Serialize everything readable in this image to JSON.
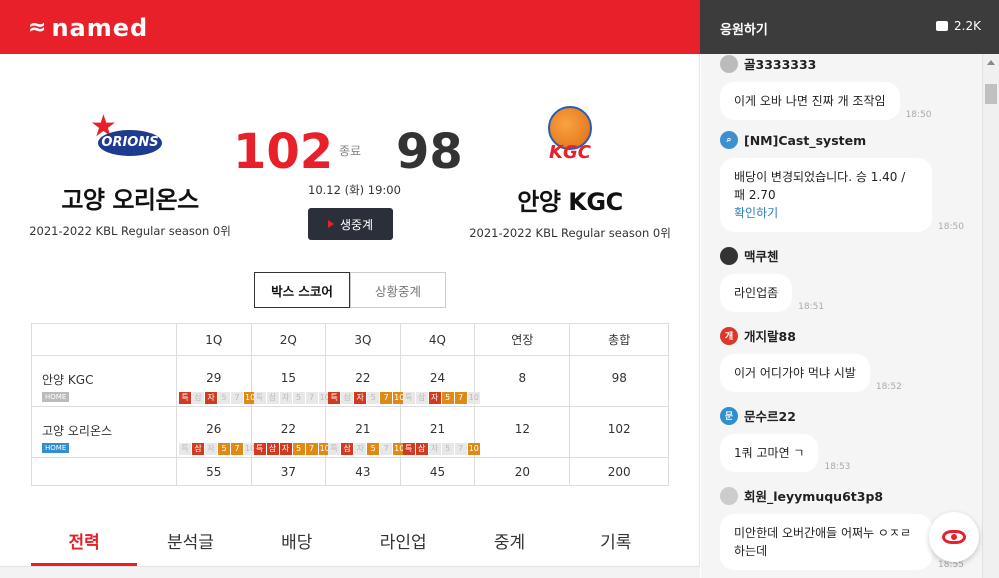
{
  "app": {
    "logo_text": "named",
    "logo_mark": "≈"
  },
  "chat_header": {
    "title": "응원하기",
    "count": "2.2K"
  },
  "game": {
    "away": {
      "name": "고양 오리온스",
      "season": "2021-2022 KBL Regular season 0위",
      "score": "102",
      "logo_text": "ORIONS"
    },
    "home": {
      "name": "안양 KGC",
      "season": "2021-2022 KBL Regular season 0위",
      "score": "98",
      "logo_text": "KGC"
    },
    "status": "종료",
    "datetime": "10.12 (화) 19:00",
    "live_button": "생중계"
  },
  "subtabs": [
    "박스 스코어",
    "상황중계"
  ],
  "boxscore": {
    "headers": [
      "",
      "1Q",
      "2Q",
      "3Q",
      "4Q",
      "연장",
      "총합"
    ],
    "rows": [
      {
        "team": "안양 KGC",
        "badge": "HOME",
        "scores": [
          "29",
          "15",
          "22",
          "24",
          "8",
          "98"
        ]
      },
      {
        "team": "고양 오리온스",
        "badge": "HOME",
        "scores": [
          "26",
          "22",
          "21",
          "21",
          "12",
          "102"
        ]
      }
    ],
    "totals": [
      "55",
      "37",
      "43",
      "45",
      "20",
      "200"
    ]
  },
  "tabs": [
    "전력",
    "분석글",
    "배당",
    "라인업",
    "중계",
    "기록"
  ],
  "chat": [
    {
      "user": "골3333333",
      "text": "이게 오바 나면 진짜 개 조작임",
      "time": "18:50",
      "avatar_color": "#bbbbbb",
      "avatar_text": ""
    },
    {
      "user": "[NM]Cast_system",
      "text": "배당이 변경되었습니다. 승 1.40 / 패 2.70",
      "link": "확인하기",
      "time": "18:50",
      "avatar_color": "#3d8fd1",
      "avatar_text": ""
    },
    {
      "user": "맥쿠첸",
      "text": "라인업좀",
      "time": "18:51",
      "avatar_color": "#333333",
      "avatar_text": ""
    },
    {
      "user": "개지랄88",
      "text": "이거 어디가야 먹냐 시발",
      "time": "18:52",
      "avatar_color": "#d9382b",
      "avatar_text": "개"
    },
    {
      "user": "문수르22",
      "text": "1쿼 고마연 ㄱ",
      "time": "18:53",
      "avatar_color": "#2f8fd0",
      "avatar_text": "문"
    },
    {
      "user": "회원_leyymuqu6t3p8",
      "text": "미안한데 오버간애들 어쩌누 ㅇㅈㄹ 하는데",
      "time": "18:55",
      "avatar_color": "#cccccc",
      "avatar_text": ""
    }
  ]
}
